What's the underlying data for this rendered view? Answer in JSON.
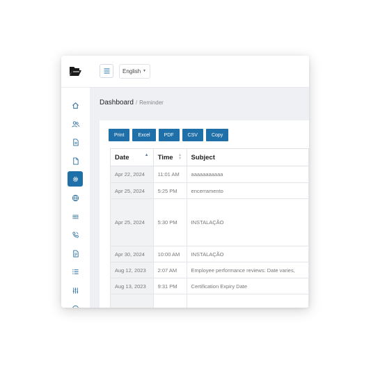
{
  "header": {
    "language": "English"
  },
  "breadcrumb": {
    "root": "Dashboard",
    "separator": "/",
    "current": "Reminder"
  },
  "export_buttons": [
    "Print",
    "Excel",
    "PDF",
    "CSV",
    "Copy"
  ],
  "table": {
    "columns": [
      "Date",
      "Time",
      "Subject"
    ],
    "rows": [
      {
        "date": "Apr 22, 2024",
        "time": "11:01 AM",
        "subject": "aaaaaaaaaaa"
      },
      {
        "date": "Apr 25, 2024",
        "time": "5:25 PM",
        "subject": "encerramento"
      },
      {
        "date": "Apr 25, 2024",
        "time": "5:30 PM",
        "subject": "INSTALAÇÃO"
      },
      {
        "date": "Apr 30, 2024",
        "time": "10:00 AM",
        "subject": "INSTALAÇÃO"
      },
      {
        "date": "Aug 12, 2023",
        "time": "2:07 AM",
        "subject": "Employee performance reviews: Date varies,"
      },
      {
        "date": "Aug 13, 2023",
        "time": "9:31 PM",
        "subject": "Certification Expiry Date"
      },
      {
        "date": "",
        "time": "",
        "subject": ""
      }
    ]
  },
  "sidebar": {
    "items": [
      {
        "icon": "home-icon"
      },
      {
        "icon": "users-icon"
      },
      {
        "icon": "document-icon"
      },
      {
        "icon": "file-icon"
      },
      {
        "icon": "settings-icon",
        "active": true
      },
      {
        "icon": "globe-icon"
      },
      {
        "icon": "filter-list-icon"
      },
      {
        "icon": "phone-icon"
      },
      {
        "icon": "report-icon"
      },
      {
        "icon": "list-icon"
      },
      {
        "icon": "sliders-icon"
      },
      {
        "icon": "help-icon"
      }
    ]
  },
  "colors": {
    "primary": "#1f6fa8",
    "content_bg": "#eef0f4",
    "icon": "#2a6f9e"
  }
}
